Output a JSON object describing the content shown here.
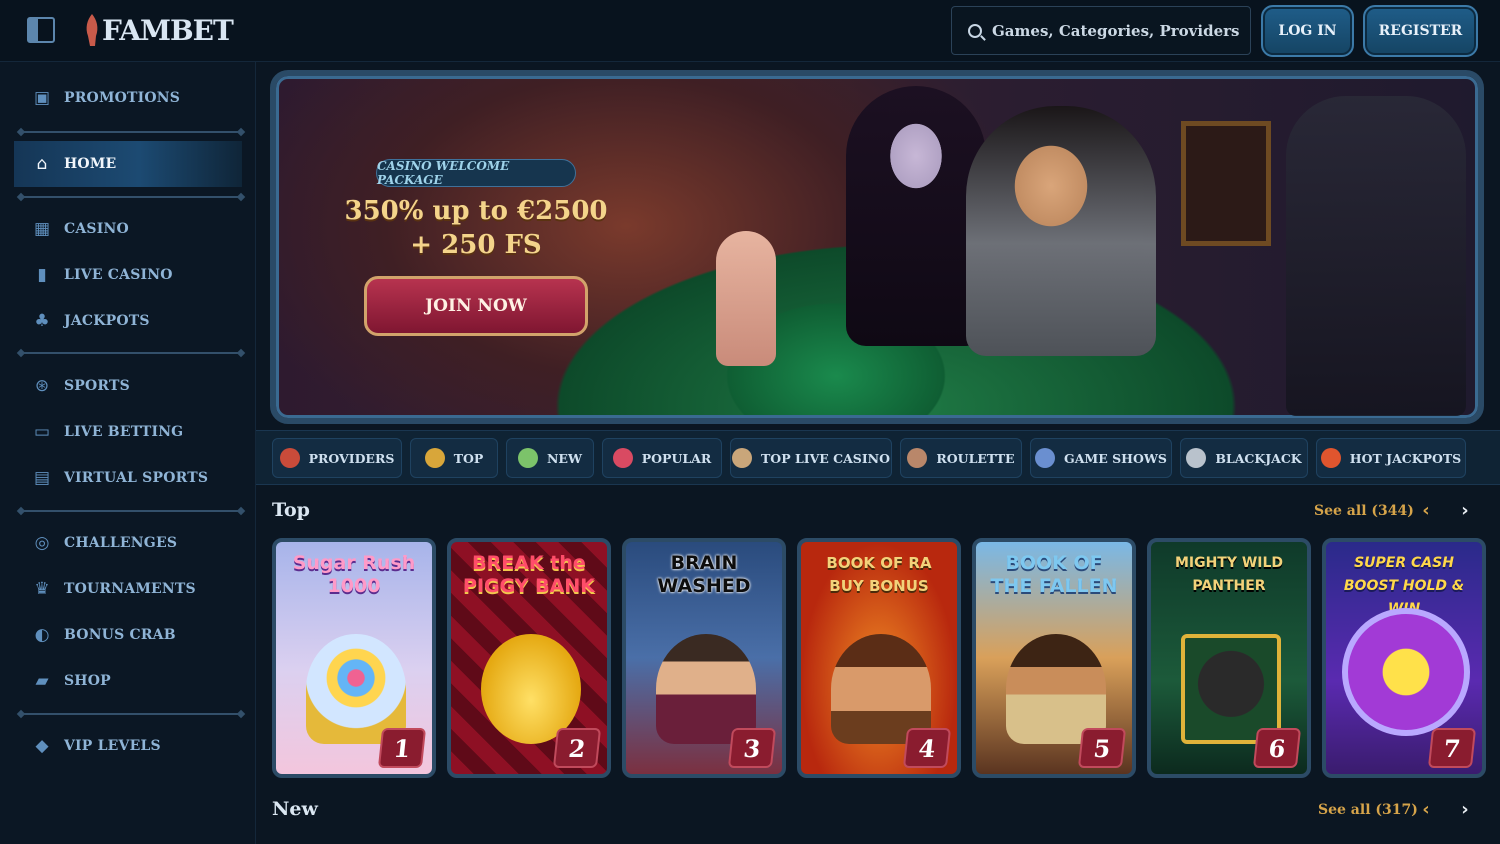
{
  "header": {
    "logo_text": "FAMBET",
    "search_placeholder": "Games, Categories, Providers",
    "login_label": "LOG IN",
    "register_label": "REGISTER"
  },
  "sidebar": {
    "items": [
      {
        "label": "PROMOTIONS",
        "icon": "gift-icon"
      },
      {
        "label": "HOME",
        "icon": "home-icon",
        "active": true
      },
      {
        "label": "CASINO",
        "icon": "slot-machine-icon"
      },
      {
        "label": "LIVE CASINO",
        "icon": "live-dealer-icon"
      },
      {
        "label": "JACKPOTS",
        "icon": "clover-icon"
      },
      {
        "label": "SPORTS",
        "icon": "ball-icon"
      },
      {
        "label": "LIVE BETTING",
        "icon": "live-badge-icon"
      },
      {
        "label": "VIRTUAL SPORTS",
        "icon": "virtual-screen-icon"
      },
      {
        "label": "CHALLENGES",
        "icon": "target-icon"
      },
      {
        "label": "TOURNAMENTS",
        "icon": "trophy-icon"
      },
      {
        "label": "BONUS CRAB",
        "icon": "claw-icon"
      },
      {
        "label": "SHOP",
        "icon": "shopping-bag-icon"
      },
      {
        "label": "VIP LEVELS",
        "icon": "diamond-icon"
      }
    ]
  },
  "banner": {
    "tag": "CASINO WELCOME PACKAGE",
    "title_line1": "350% up to €2500",
    "title_line2": "+ 250 FS",
    "cta": "JOIN NOW"
  },
  "categories": [
    {
      "label": "PROVIDERS",
      "color": "#c94b3a"
    },
    {
      "label": "TOP",
      "color": "#d8a63a"
    },
    {
      "label": "NEW",
      "color": "#7cc36a"
    },
    {
      "label": "POPULAR",
      "color": "#d94a62"
    },
    {
      "label": "TOP LIVE CASINO",
      "color": "#c9a67a"
    },
    {
      "label": "ROULETTE",
      "color": "#b9876a"
    },
    {
      "label": "GAME SHOWS",
      "color": "#6a8fd0"
    },
    {
      "label": "BLACKJACK",
      "color": "#b9c2cc"
    },
    {
      "label": "HOT JACKPOTS",
      "color": "#e0552e"
    }
  ],
  "top_section": {
    "title": "Top",
    "see_all": "See all (344)",
    "games": [
      {
        "title": "Sugar Rush 1000",
        "rank": "1"
      },
      {
        "title": "BREAK the PIGGY BANK",
        "rank": "2"
      },
      {
        "title": "BRAIN WASHED",
        "rank": "3"
      },
      {
        "title": "BOOK OF RA BUY BONUS",
        "rank": "4"
      },
      {
        "title": "BOOK OF THE FALLEN",
        "rank": "5"
      },
      {
        "title": "MIGHTY WILD PANTHER",
        "rank": "6"
      },
      {
        "title": "SUPER CASH BOOST HOLD & WIN",
        "rank": "7"
      }
    ]
  },
  "new_section": {
    "title": "New",
    "see_all": "See all (317)"
  },
  "arrows": {
    "prev": "‹",
    "next": "›"
  }
}
